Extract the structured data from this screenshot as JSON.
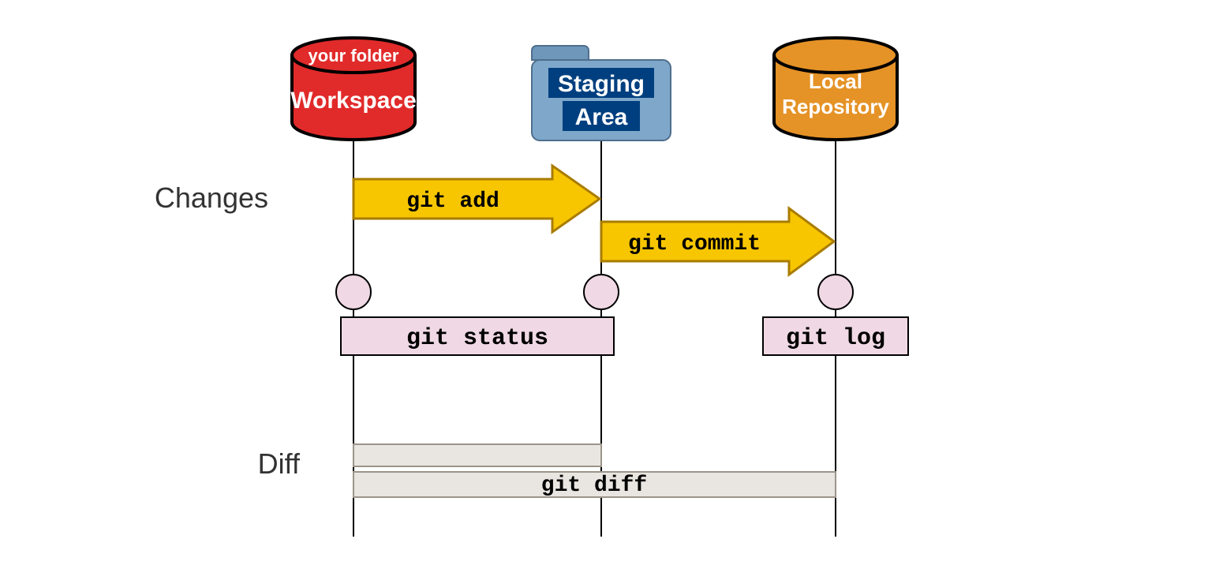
{
  "locations": {
    "workspace": {
      "caption": "your folder",
      "label": "Workspace"
    },
    "staging": {
      "label_line1": "Staging",
      "label_line2": "Area"
    },
    "local": {
      "label_line1": "Local",
      "label_line2": "Repository"
    }
  },
  "row_labels": {
    "changes": "Changes",
    "diff": "Diff"
  },
  "arrows": {
    "git_add": "git add",
    "git_commit": "git commit"
  },
  "info_boxes": {
    "git_status": "git status",
    "git_log": "git log"
  },
  "diff_row": {
    "git_diff": "git diff"
  },
  "colors": {
    "workspace_fill": "#E12A2A",
    "workspace_stroke": "#000000",
    "staging_fill": "#7FA7C9",
    "staging_tab": "#6F97B9",
    "staging_text_bg": "#003F7F",
    "local_fill": "#E59226",
    "local_stroke": "#000000",
    "arrow_fill": "#F7C600",
    "arrow_stroke": "#A97C00",
    "pink_fill": "#F0D9E4",
    "pink_stroke": "#000000",
    "grey_fill": "#E9E6E1",
    "grey_stroke": "#9B958A",
    "line": "#000000"
  }
}
